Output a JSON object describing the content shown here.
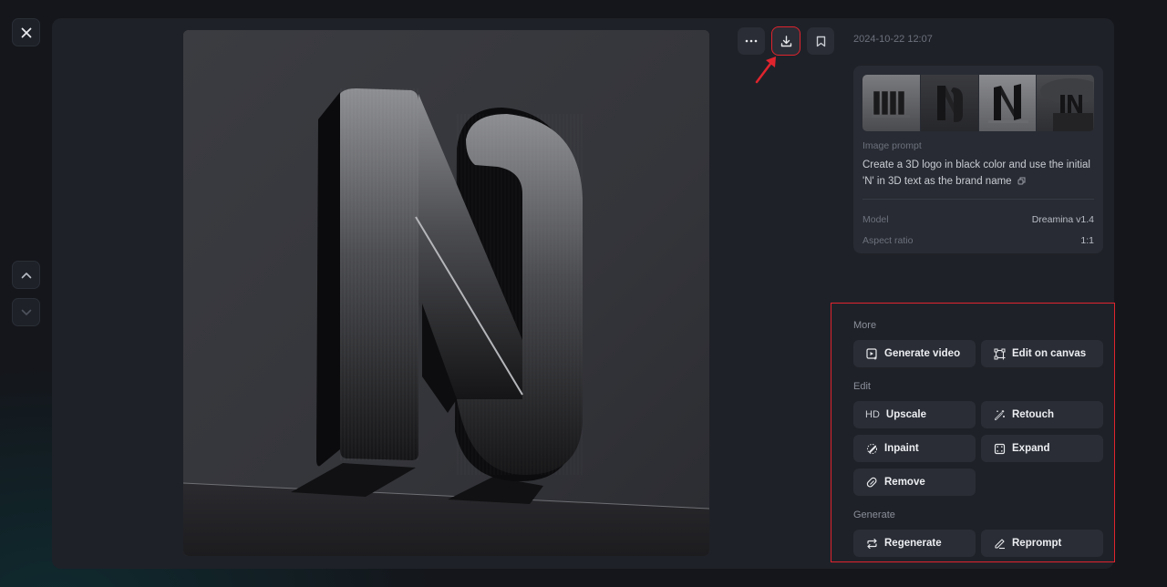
{
  "header": {
    "close_label": "Close",
    "timestamp": "2024-10-22 12:07"
  },
  "toolbar": {
    "more_icon": "ellipsis-icon",
    "download_icon": "download-icon",
    "bookmark_icon": "bookmark-icon"
  },
  "navigation": {
    "prev_icon": "chevron-up-icon",
    "next_icon": "chevron-down-icon"
  },
  "main_image": {
    "description": "3D black brushed-metal letter N logo on dark gray background"
  },
  "info": {
    "thumbnails": [
      {
        "description": "NNN 3D black logo variant"
      },
      {
        "description": "Curved N 3D logo variant"
      },
      {
        "description": "Angular N 3D logo variant (selected)"
      },
      {
        "description": "IN 3D logo variant on platform"
      }
    ],
    "prompt_label": "Image prompt",
    "prompt_text": "Create a 3D logo in black color and use the initial 'N' in 3D text as the brand name",
    "model_label": "Model",
    "model_value": "Dreamina v1.4",
    "aspect_label": "Aspect ratio",
    "aspect_value": "1:1"
  },
  "actions": {
    "more_label": "More",
    "edit_label": "Edit",
    "generate_label": "Generate",
    "more": [
      {
        "label": "Generate video",
        "icon": "video-play-icon"
      },
      {
        "label": "Edit on canvas",
        "icon": "canvas-icon"
      }
    ],
    "edit": [
      {
        "label": "Upscale",
        "icon": "HD"
      },
      {
        "label": "Retouch",
        "icon": "magic-wand-icon"
      },
      {
        "label": "Inpaint",
        "icon": "brush-icon"
      },
      {
        "label": "Expand",
        "icon": "expand-icon"
      },
      {
        "label": "Remove",
        "icon": "eraser-icon"
      }
    ],
    "generate": [
      {
        "label": "Regenerate",
        "icon": "repeat-icon"
      },
      {
        "label": "Reprompt",
        "icon": "pencil-icon"
      }
    ]
  },
  "colors": {
    "highlight": "#e0242e",
    "panel": "#1f2128",
    "button": "#2a2d35"
  }
}
